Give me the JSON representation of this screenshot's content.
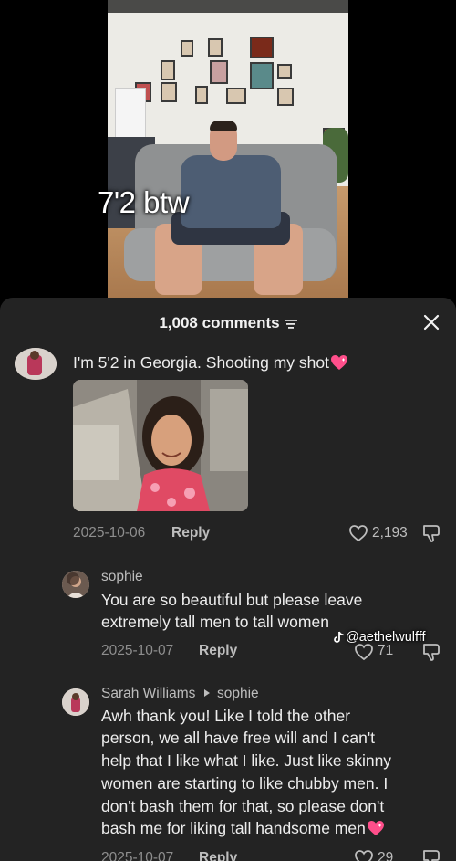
{
  "video": {
    "caption": "7'2 btw"
  },
  "comments_header": {
    "count_label": "1,008 comments"
  },
  "comment_main": {
    "text": "I'm 5'2 in Georgia. Shooting my shot",
    "date": "2025-10-06",
    "reply_label": "Reply",
    "likes": "2,193"
  },
  "reply_1": {
    "author": "sophie",
    "text_line1": "You are so beautiful but please leave",
    "text_line2": "extremely tall men to tall women",
    "date": "2025-10-07",
    "reply_label": "Reply",
    "likes": "71"
  },
  "reply_2": {
    "author": "Sarah Williams",
    "replying_to": "sophie",
    "text_line1": "Awh thank you! Like I told the other",
    "text_line2": "person, we all have free will and I can't",
    "text_line3": "help that I like what I like. Just like skinny",
    "text_line4": "women are starting to like chubby men. I",
    "text_line5": "don't bash them for that, so please don't",
    "text_line6": "bash me for liking tall handsome men",
    "date": "2025-10-07",
    "reply_label": "Reply",
    "likes": "29"
  },
  "watermark": {
    "handle": "@aethelwulfff"
  },
  "colors": {
    "sheet_bg": "#232323",
    "heart_emoji": "#ff4f8b"
  },
  "icons": [
    "filter-icon",
    "close-icon",
    "heart-icon",
    "dislike-icon",
    "tiktok-icon",
    "heart-emoji"
  ]
}
